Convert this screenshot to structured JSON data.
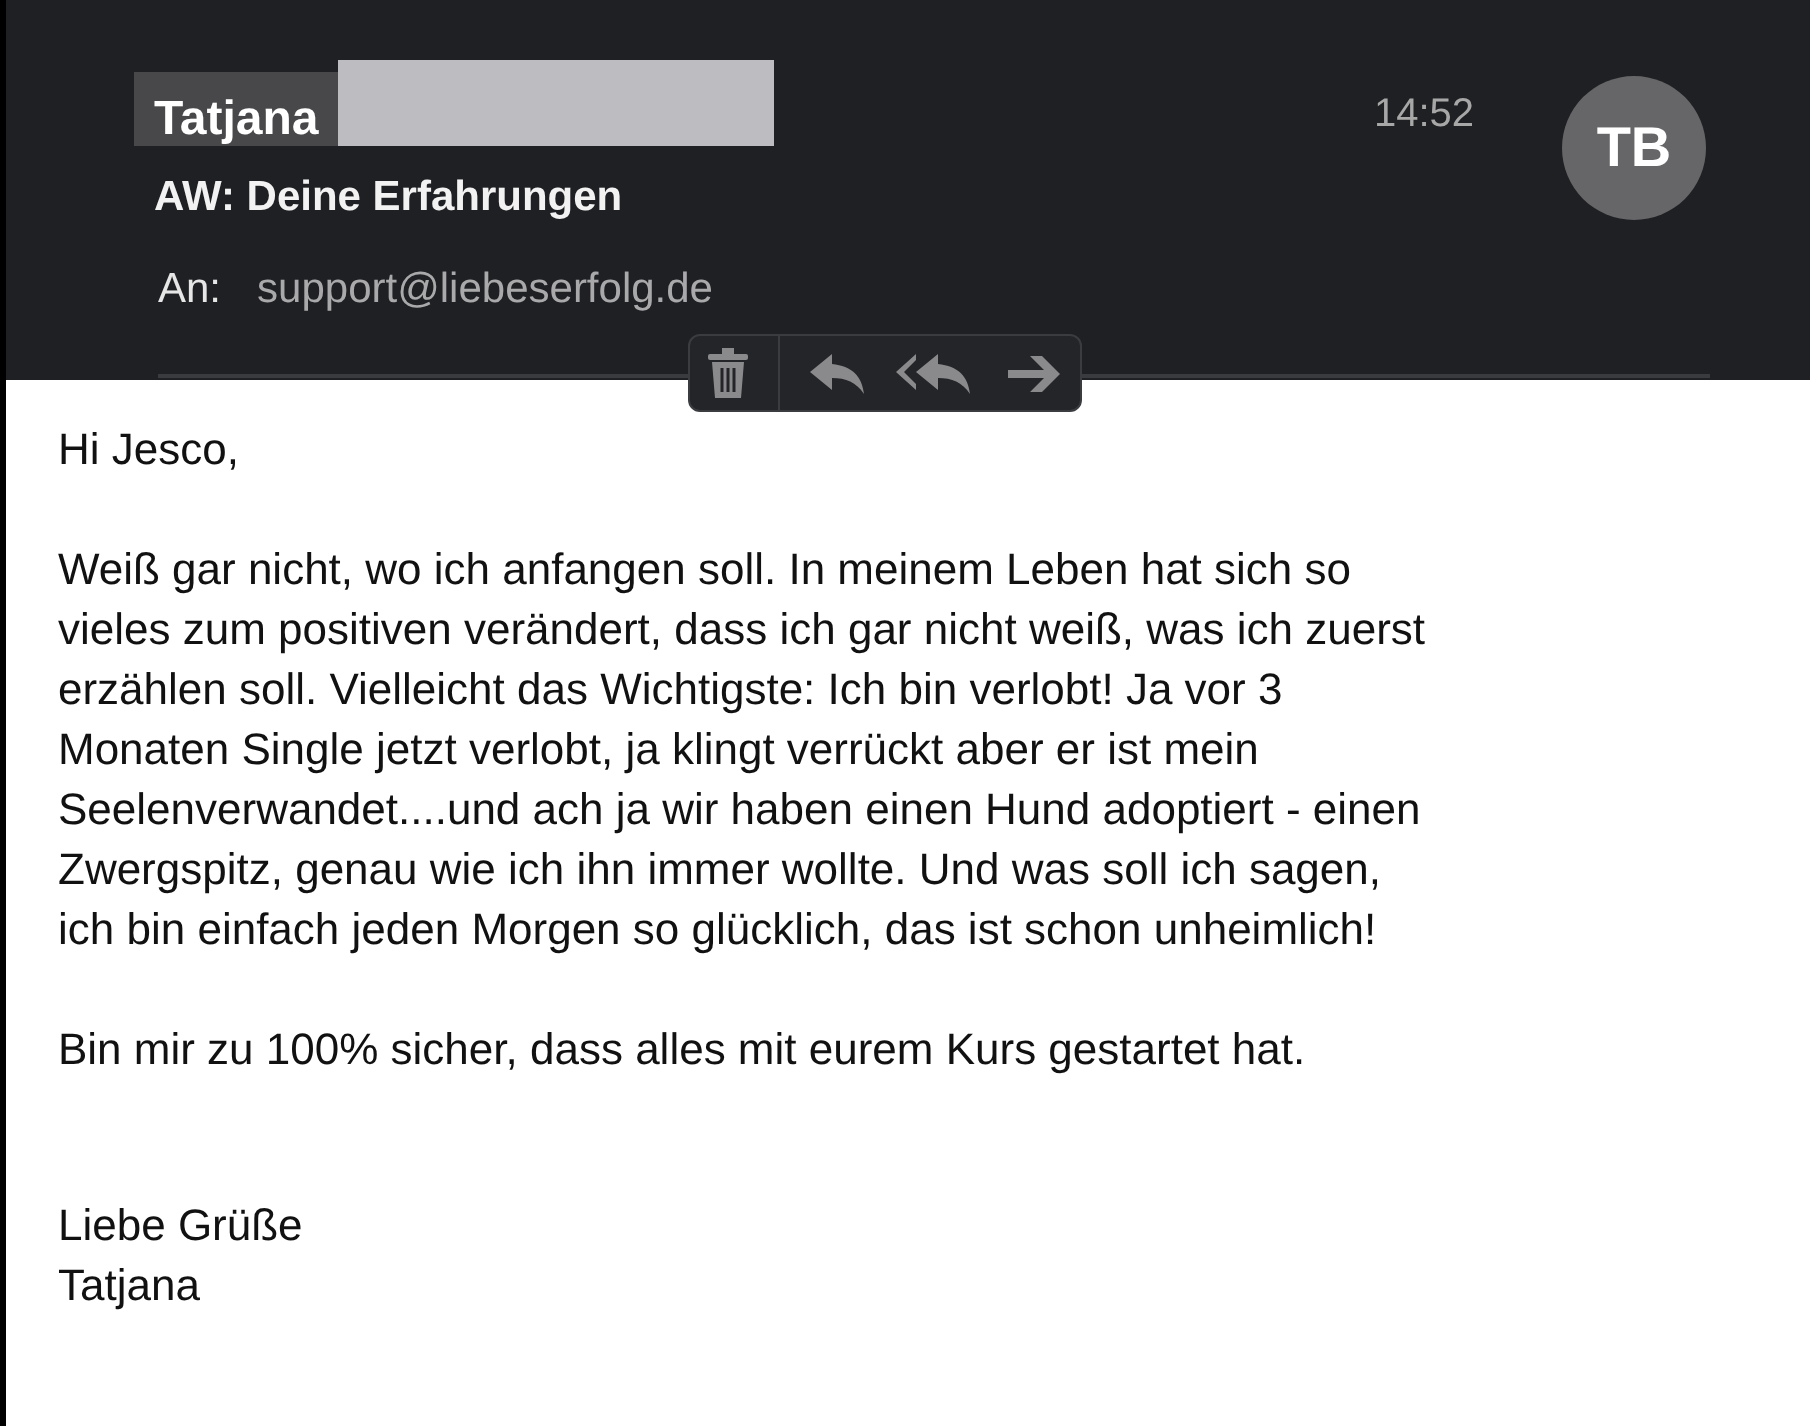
{
  "header": {
    "sender": "Tatjana",
    "sender_redacted": true,
    "subject": "AW: Deine Erfahrungen",
    "to_label": "An:",
    "to_address": "support@liebeserfolg.de",
    "time": "14:52",
    "avatar_initials": "TB"
  },
  "toolbar": [
    {
      "kind": "delete"
    },
    {
      "kind": "reply"
    },
    {
      "kind": "reply-all"
    },
    {
      "kind": "forward"
    }
  ],
  "body": [
    {
      "lines": [
        "Hi Jesco,"
      ]
    },
    {
      "lines": [
        "Weiß gar nicht, wo ich anfangen soll. In meinem Leben hat sich so",
        "vieles zum positiven verändert, dass ich gar nicht weiß, was ich zuerst",
        "erzählen soll. Vielleicht das Wichtigste: Ich bin verlobt! Ja vor 3",
        "Monaten Single jetzt verlobt, ja klingt verrückt aber er ist mein",
        "Seelenverwandet....und ach ja wir haben einen Hund adoptiert - einen",
        "Zwergspitz, genau wie ich ihn immer wollte. Und was soll ich sagen,",
        "ich bin einfach jeden Morgen so glücklich, das ist schon unheimlich!"
      ]
    },
    {
      "lines": [
        "Bin mir zu 100% sicher, dass alles mit eurem Kurs gestartet hat."
      ]
    },
    {
      "lines": [
        "Liebe Grüße",
        "Tatjana"
      ]
    }
  ]
}
